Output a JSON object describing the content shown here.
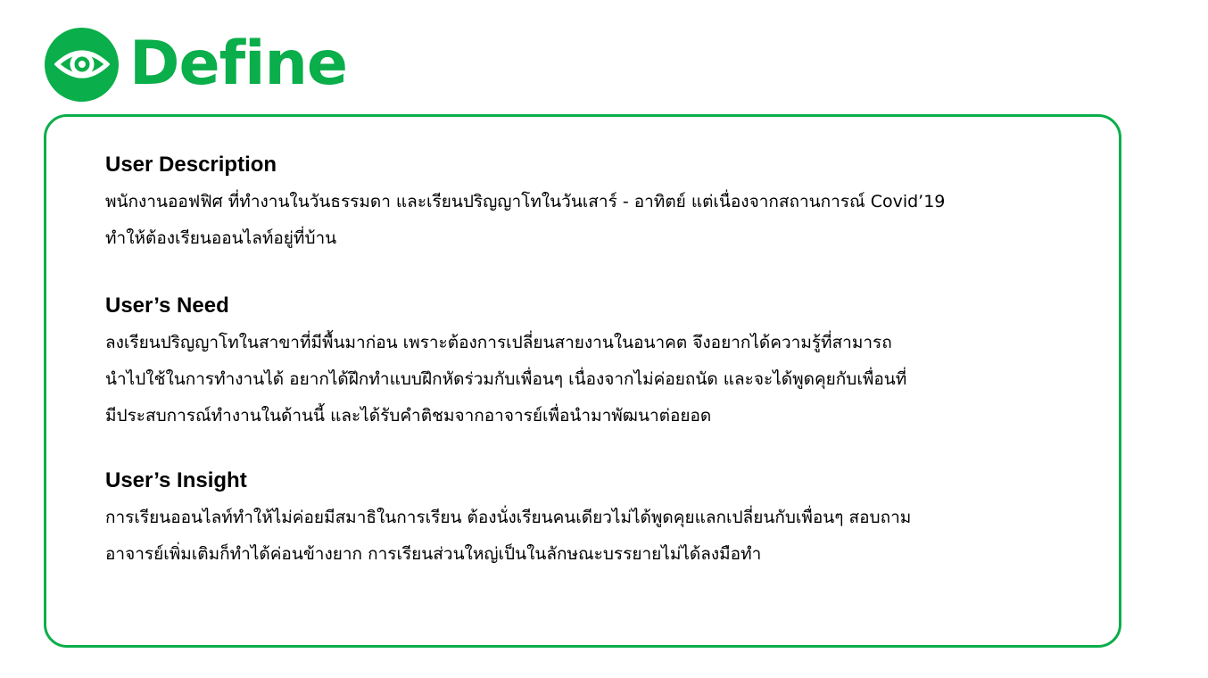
{
  "header": {
    "title": "Define",
    "icon": "eye-icon",
    "accent_color": "#0aae4a"
  },
  "sections": [
    {
      "heading": "User Description",
      "lines": [
        "พนักงานออฟฟิศ ที่ทำงานในวันธรรมดา และเรียนปริญญาโทในวันเสาร์ - อาทิตย์ แต่เนื่องจากสถานการณ์ Covid’19",
        "ทำให้ต้องเรียนออนไลท์อยู่ที่บ้าน"
      ]
    },
    {
      "heading": "User’s Need",
      "lines": [
        "ลงเรียนปริญญาโทในสาขาที่มีพื้นมาก่อน เพราะต้องการเปลี่ยนสายงานในอนาคต จึงอยากได้ความรู้ที่สามารถ",
        "นำไปใช้ในการทำงานได้ อยากได้ฝึกทำแบบฝึกหัดร่วมกับเพื่อนๆ เนื่องจากไม่ค่อยถนัด และจะได้พูดคุยกับเพื่อนที่",
        "มีประสบการณ์ทำงานในด้านนี้  และได้รับคำติชมจากอาจารย์เพื่อนำมาพัฒนาต่อยอด"
      ]
    },
    {
      "heading": "User’s Insight",
      "lines": [
        "การเรียนออนไลท์ทำให้ไม่ค่อยมีสมาธิในการเรียน ต้องนั่งเรียนคนเดียวไม่ได้พูดคุยแลกเปลี่ยนกับเพื่อนๆ สอบถาม",
        "อาจารย์เพิ่มเติมก็ทำได้ค่อนข้างยาก การเรียนส่วนใหญ่เป็นในลักษณะบรรยายไม่ได้ลงมือทำ"
      ]
    }
  ]
}
